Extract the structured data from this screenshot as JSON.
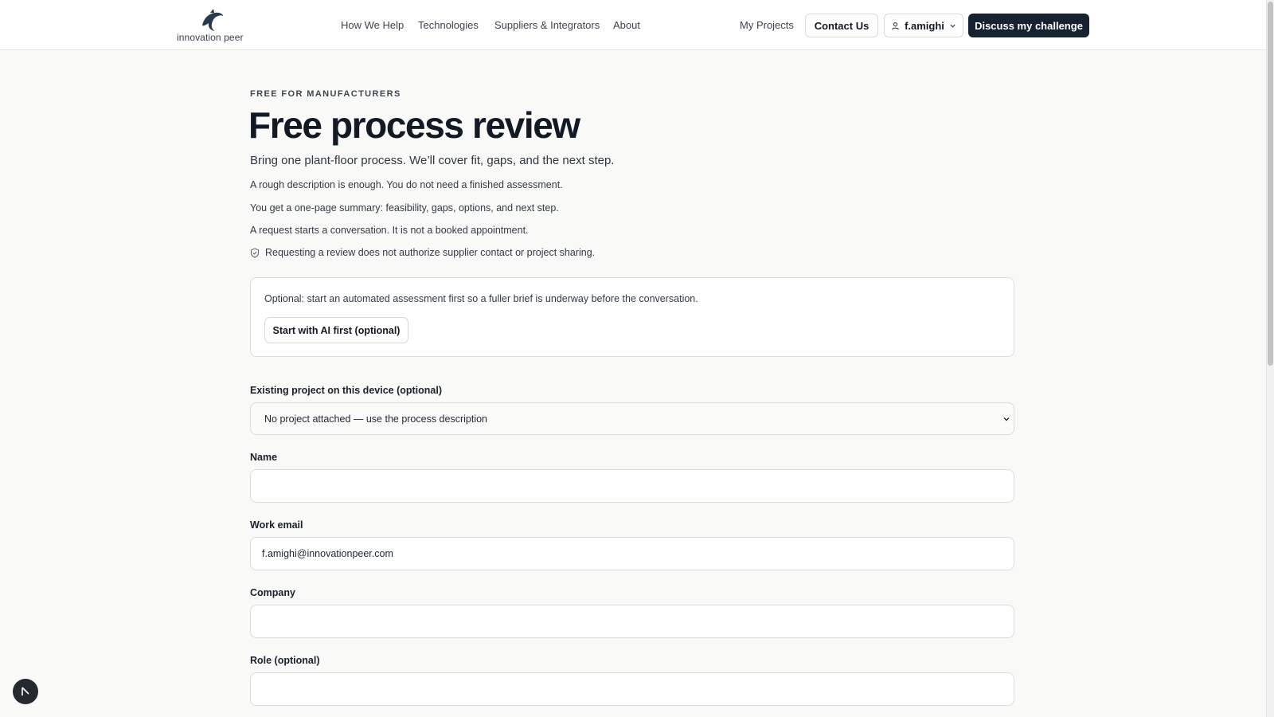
{
  "header": {
    "logo_text": "innovation peer",
    "nav": [
      "How We Help",
      "Technologies",
      "Suppliers & Integrators",
      "About"
    ],
    "my_projects": "My Projects",
    "contact_us": "Contact Us",
    "user_name": "f.amighi",
    "cta": "Discuss my challenge"
  },
  "hero": {
    "eyebrow": "FREE FOR MANUFACTURERS",
    "title": "Free process review",
    "lead": "Bring one plant-floor process. We’ll cover fit, gaps, and the next step.",
    "points": [
      "A rough description is enough. You do not need a finished assessment.",
      "You get a one-page summary: feasibility, gaps, options, and next step.",
      "A request starts a conversation. It is not a booked appointment."
    ],
    "note": "Requesting a review does not authorize supplier contact or project sharing."
  },
  "optional_card": {
    "text": "Optional: start an automated assessment first so a fuller brief is underway before the conversation.",
    "button": "Start with AI first (optional)"
  },
  "form": {
    "existing_project_label": "Existing project on this device (optional)",
    "existing_project_value": "No project attached — use the process description",
    "name_label": "Name",
    "name_value": "",
    "email_label": "Work email",
    "email_value": "f.amighi@innovationpeer.com",
    "company_label": "Company",
    "company_value": "",
    "role_label": "Role (optional)",
    "role_value": ""
  },
  "colors": {
    "page_bg": "#f9f9f7",
    "primary_dark": "#162131",
    "border": "#dcdcd8"
  },
  "icons": {
    "logo": "dolphin-logo-icon",
    "user": "user-icon",
    "dropdown": "chevron-down-icon",
    "note": "shield-check-icon",
    "fab": "cursor-arrow-icon"
  }
}
